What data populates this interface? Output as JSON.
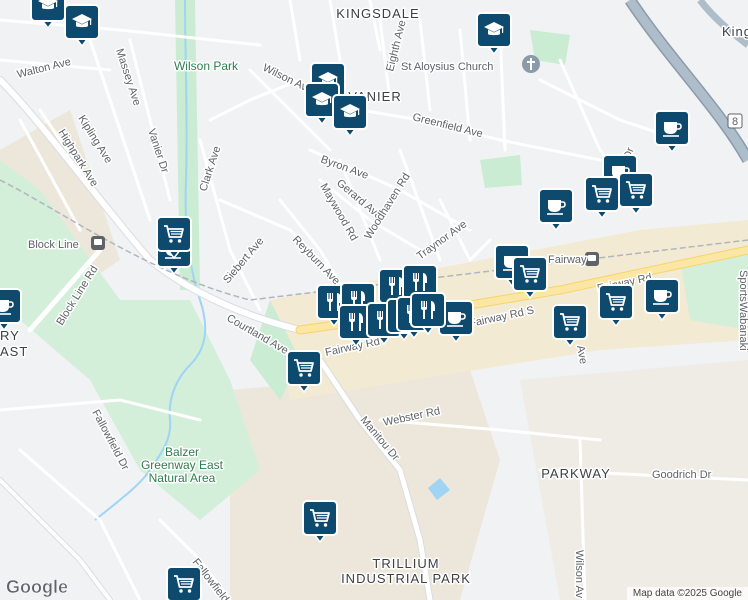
{
  "areas": {
    "kingsdale": "KINGSDALE",
    "vanier": "VANIER",
    "parkway": "PARKWAY",
    "industrial_1": "TRILLIUM",
    "industrial_2": "INDUSTRIAL PARK",
    "king": "King",
    "ry": "RY",
    "ast": "AST"
  },
  "parks": {
    "wilson_park": "Wilson Park",
    "balzer_1": "Balzer",
    "balzer_2": "Greenway East",
    "balzer_3": "Natural Area"
  },
  "places": {
    "church": "St Aloysius Church",
    "block_line_station": "Block Line",
    "fairway_station": "Fairway"
  },
  "streets": {
    "walton": "Walton Ave",
    "massey": "Massey Ave",
    "kipling": "Kipling Ave",
    "highpark": "Highpark Ave",
    "vanier_dr": "Vanier Dr",
    "clark": "Clark Ave",
    "wilson_ave": "Wilson Ave",
    "eighth": "Eighth Ave",
    "greenfield": "Greenfield Ave",
    "byron": "Byron Ave",
    "gerard": "Gerard Ave",
    "maywood": "Maywood Rd",
    "woodhaven": "Woodhaven Rd",
    "traynor": "Traynor Ave",
    "reyburn": "Reyburn Ave",
    "siebert": "Siebert Ave",
    "block_line_rd": "Block Line Rd",
    "courtland": "Courtland Ave",
    "fairway_rd": "Fairway Rd",
    "fairway_rd_s": "Fairway Rd S",
    "manitou": "Manitou Dr",
    "webster": "Webster Rd",
    "fallowfield": "Fallowfield Dr",
    "fallowfield_2": "Fallowfield",
    "goodrich": "Goodrich Dr",
    "wilson_av2": "Wilson Av",
    "ave": "Ave",
    "dr": "Dr",
    "sportsworld": "Sportsworld",
    "wabanaki": "Wabanaki",
    "highway_8": "8"
  },
  "branding": {
    "logo": "Google",
    "attribution": "Map data ©2025 Google"
  },
  "colors": {
    "marker": "#0d4a6e",
    "road_major": "#fbe7a3",
    "park": "#c9ecd2",
    "water": "#9fd4f5",
    "industrial": "#ece7da"
  },
  "markers": [
    {
      "type": "school",
      "icon": "graduation-cap-icon"
    },
    {
      "type": "school",
      "icon": "graduation-cap-icon"
    },
    {
      "type": "school",
      "icon": "graduation-cap-icon"
    },
    {
      "type": "school",
      "icon": "graduation-cap-icon"
    },
    {
      "type": "school",
      "icon": "graduation-cap-icon"
    },
    {
      "type": "school",
      "icon": "graduation-cap-icon"
    },
    {
      "type": "cafe",
      "icon": "coffee-cup-icon"
    },
    {
      "type": "cafe",
      "icon": "coffee-cup-icon"
    },
    {
      "type": "cafe",
      "icon": "coffee-cup-icon"
    },
    {
      "type": "cafe",
      "icon": "coffee-cup-icon"
    },
    {
      "type": "cafe",
      "icon": "coffee-cup-icon"
    },
    {
      "type": "cafe",
      "icon": "coffee-cup-icon"
    },
    {
      "type": "cafe",
      "icon": "coffee-cup-icon"
    },
    {
      "type": "cafe",
      "icon": "coffee-cup-icon"
    },
    {
      "type": "grocery",
      "icon": "shopping-cart-icon"
    },
    {
      "type": "grocery",
      "icon": "shopping-cart-icon"
    },
    {
      "type": "grocery",
      "icon": "shopping-cart-icon"
    },
    {
      "type": "grocery",
      "icon": "shopping-cart-icon"
    },
    {
      "type": "grocery",
      "icon": "shopping-cart-icon"
    },
    {
      "type": "grocery",
      "icon": "shopping-cart-icon"
    },
    {
      "type": "grocery",
      "icon": "shopping-cart-icon"
    },
    {
      "type": "grocery",
      "icon": "shopping-cart-icon"
    },
    {
      "type": "grocery",
      "icon": "shopping-cart-icon"
    },
    {
      "type": "restaurant",
      "icon": "fork-knife-icon"
    },
    {
      "type": "restaurant",
      "icon": "fork-knife-icon"
    },
    {
      "type": "restaurant",
      "icon": "fork-knife-icon"
    },
    {
      "type": "restaurant",
      "icon": "fork-knife-icon"
    },
    {
      "type": "restaurant",
      "icon": "fork-knife-icon"
    },
    {
      "type": "restaurant",
      "icon": "fork-knife-icon"
    },
    {
      "type": "restaurant",
      "icon": "fork-knife-icon"
    },
    {
      "type": "restaurant",
      "icon": "fork-knife-icon"
    },
    {
      "type": "restaurant",
      "icon": "fork-knife-icon"
    }
  ]
}
